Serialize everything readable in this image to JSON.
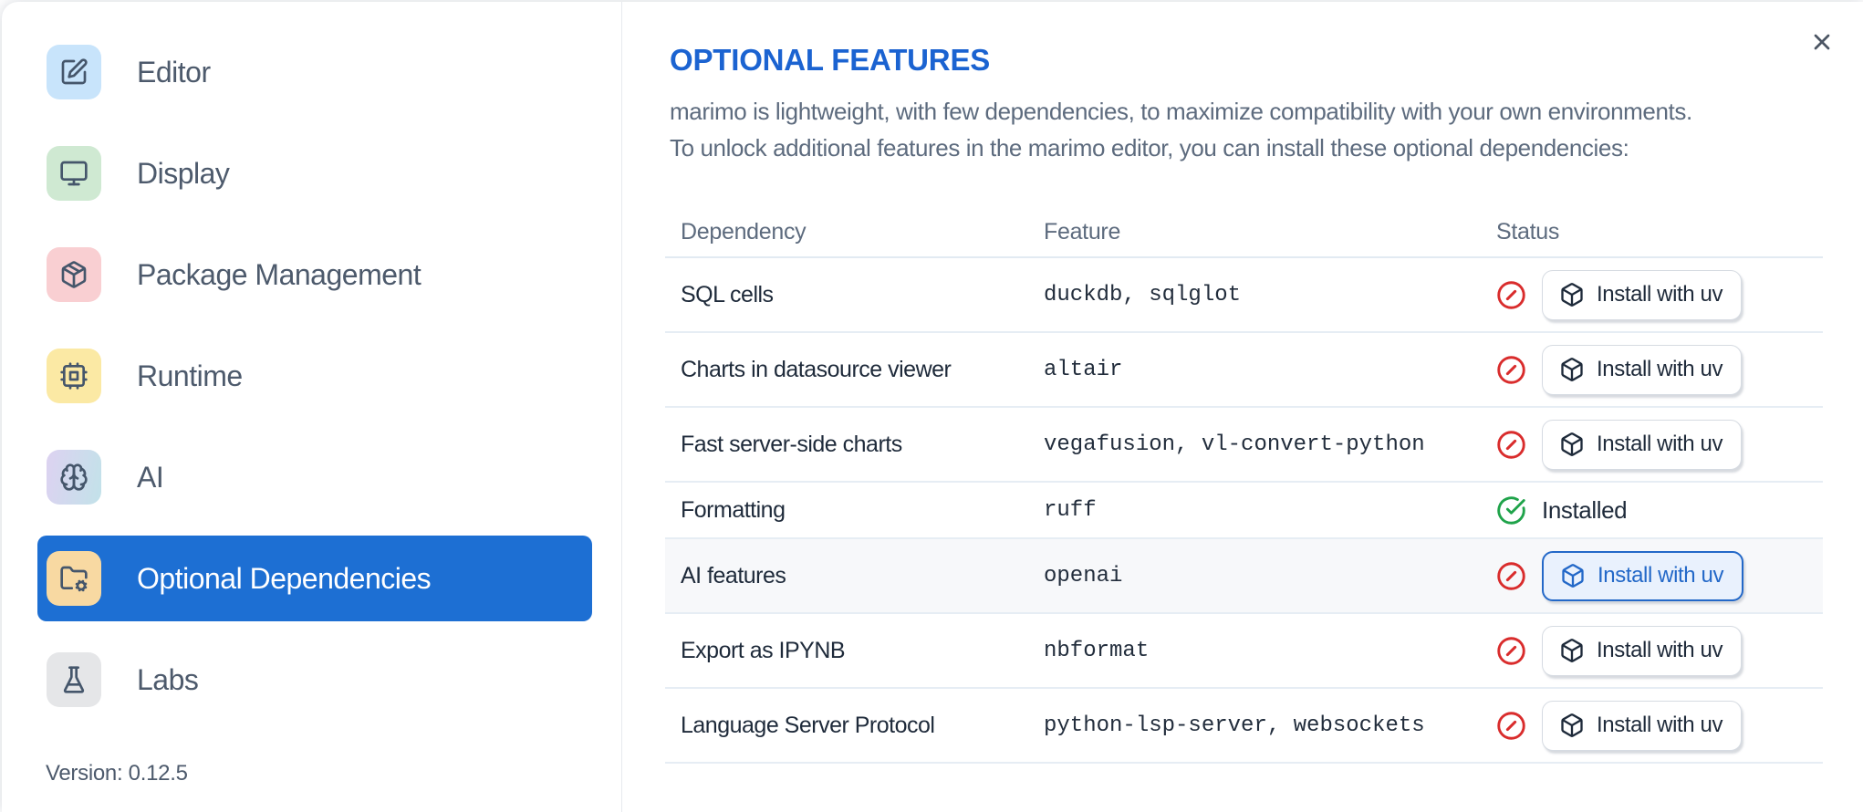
{
  "window": {
    "close_icon": "x-icon"
  },
  "colors": {
    "accent_blue": "#1d6fd3",
    "title_blue": "#1b63d1",
    "focus_button_blue": "#2368c8",
    "focus_button_bg": "#e9f1fd",
    "status_red": "#d92c2c",
    "status_green": "#1fa34a"
  },
  "sidebar": {
    "items": [
      {
        "label": "Editor",
        "icon": "square-pen",
        "tile": "#c8e4fb",
        "selected": false
      },
      {
        "label": "Display",
        "icon": "monitor",
        "tile": "#cfe9d2",
        "selected": false
      },
      {
        "label": "Package Management",
        "icon": "package",
        "tile": "#f9cfd2",
        "selected": false
      },
      {
        "label": "Runtime",
        "icon": "cpu",
        "tile": "#fbe9a4",
        "selected": false
      },
      {
        "label": "AI",
        "icon": "brain",
        "tile": "linear-gradient(100deg,#ddd2f1,#c2e2e9)",
        "selected": false
      },
      {
        "label": "Optional Dependencies",
        "icon": "folder-cog",
        "tile": "#f8d9a2",
        "selected": true
      },
      {
        "label": "Labs",
        "icon": "flask",
        "tile": "#e5e6e8",
        "selected": false
      }
    ],
    "version_label": "Version: 0.12.5"
  },
  "panel": {
    "title": "OPTIONAL FEATURES",
    "description_line1": "marimo is lightweight, with few dependencies, to maximize compatibility with your own environments.",
    "description_line2": "To unlock additional features in the marimo editor, you can install these optional dependencies:",
    "table": {
      "columns": [
        "Dependency",
        "Feature",
        "Status"
      ],
      "install_button_label": "Install with uv",
      "installed_label": "Installed",
      "rows": [
        {
          "dependency": "SQL cells",
          "feature": "duckdb, sqlglot",
          "installed": false,
          "action": "Install with uv",
          "focused": false
        },
        {
          "dependency": "Charts in datasource viewer",
          "feature": "altair",
          "installed": false,
          "action": "Install with uv",
          "focused": false
        },
        {
          "dependency": "Fast server-side charts",
          "feature": "vegafusion, vl-convert-python",
          "installed": false,
          "action": "Install with uv",
          "focused": false
        },
        {
          "dependency": "Formatting",
          "feature": "ruff",
          "installed": true,
          "status_label": "Installed",
          "focused": false
        },
        {
          "dependency": "AI features",
          "feature": "openai",
          "installed": false,
          "action": "Install with uv",
          "focused": true
        },
        {
          "dependency": "Export as IPYNB",
          "feature": "nbformat",
          "installed": false,
          "action": "Install with uv",
          "focused": false
        },
        {
          "dependency": "Language Server Protocol",
          "feature": "python-lsp-server, websockets",
          "installed": false,
          "action": "Install with uv",
          "focused": false
        }
      ]
    }
  }
}
